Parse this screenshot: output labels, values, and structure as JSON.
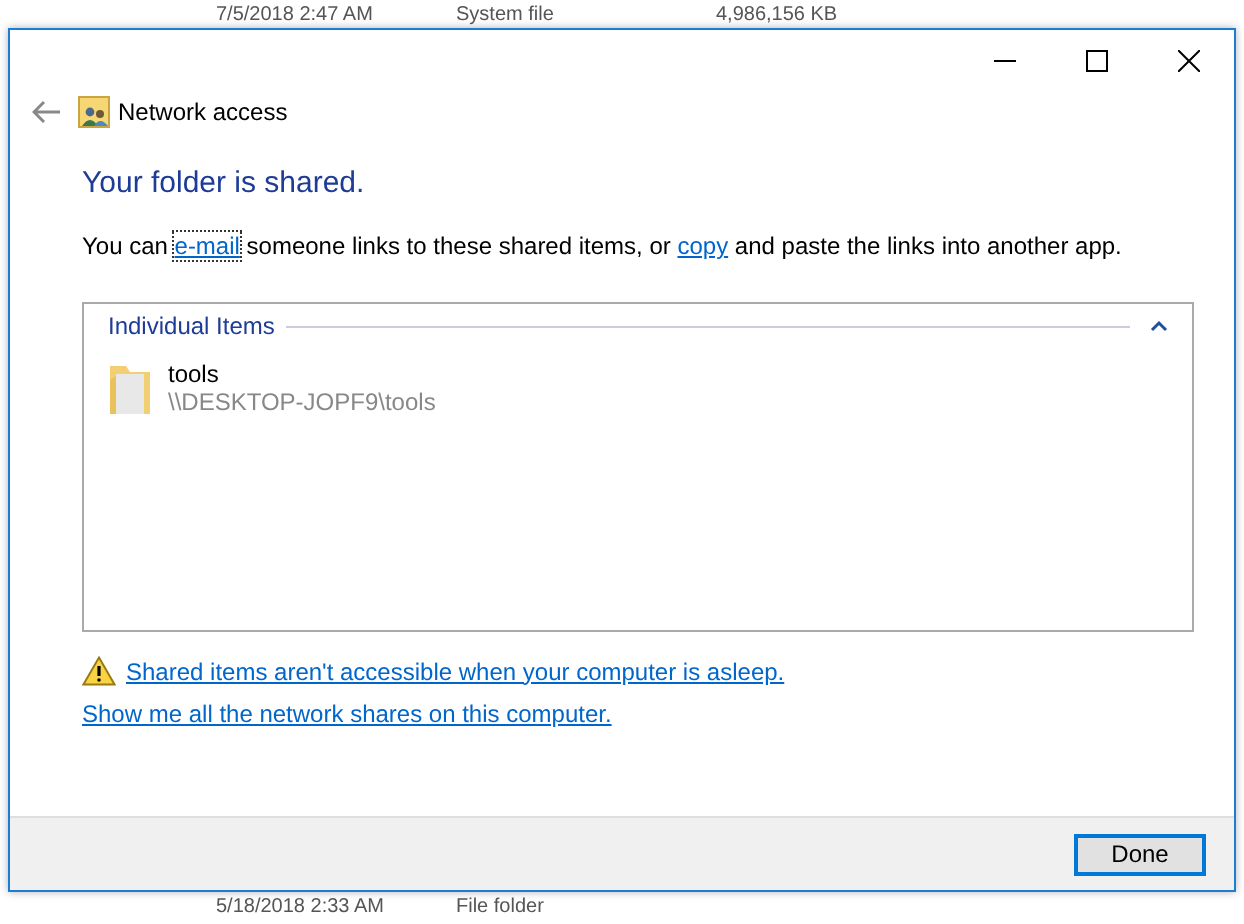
{
  "background_rows_above": [
    {
      "cells": [
        "7/5/2018 2:47 AM",
        "System file",
        "4,986,156 KB"
      ]
    }
  ],
  "window": {
    "title": "Network access",
    "caption_buttons": [
      {
        "kind": "minimize"
      },
      {
        "kind": "maximize"
      },
      {
        "kind": "close"
      }
    ]
  },
  "heading": "Your folder is shared.",
  "message": {
    "before": "You can ",
    "link_1": "e-mail",
    "middle": " someone links to these shared items, or ",
    "link_2": "copy",
    "after": " and paste the links into another app."
  },
  "group": {
    "title": "Individual Items",
    "expanded": true,
    "items": [
      {
        "name": "tools",
        "path": "\\\\DESKTOP-JOPF9\\tools"
      }
    ]
  },
  "warning_link": "Shared items aren't accessible when your computer is asleep.",
  "shares_link": "Show me all the network shares on this computer.",
  "buttons": [
    "Done"
  ],
  "background_rows_below": [
    {
      "cells": [
        "5/18/2018 2:33 AM",
        "File folder"
      ]
    }
  ]
}
